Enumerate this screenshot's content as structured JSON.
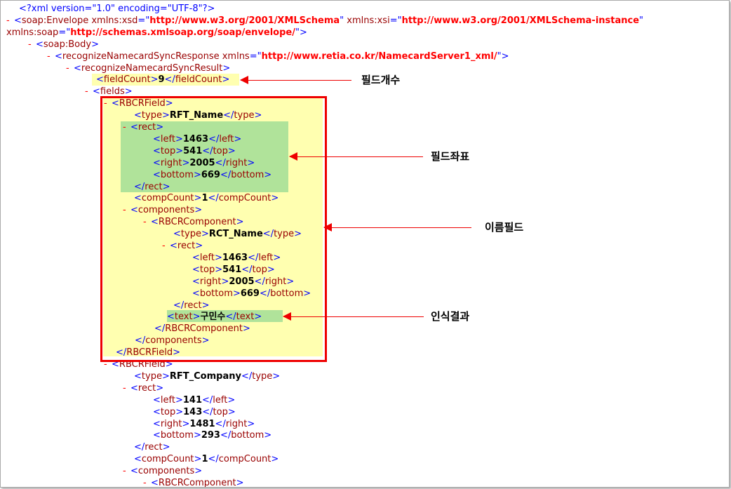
{
  "xml_lines": [
    {
      "parts": [
        {
          "t": "<?xml version=\"1.0\" encoding=\"UTF-8\"?>",
          "c": "p"
        }
      ]
    },
    {
      "parts": [
        {
          "t": "-",
          "c": "m"
        },
        {
          "t": "<",
          "c": "p"
        },
        {
          "t": "soap:Envelope",
          "c": "tn"
        },
        {
          "t": " xmlns:xsd",
          "c": "an"
        },
        {
          "t": "=\"",
          "c": "p"
        },
        {
          "t": "http://www.w3.org/2001/XMLSchema",
          "c": "av"
        },
        {
          "t": "\"",
          "c": "p"
        },
        {
          "t": " xmlns:xsi",
          "c": "an"
        },
        {
          "t": "=\"",
          "c": "p"
        },
        {
          "t": "http://www.w3.org/2001/XMLSchema-instance",
          "c": "av"
        },
        {
          "t": "\"",
          "c": "p"
        }
      ]
    },
    {
      "parts": [
        {
          "t": "xmlns:soap",
          "c": "an"
        },
        {
          "t": "=\"",
          "c": "p"
        },
        {
          "t": "http://schemas.xmlsoap.org/soap/envelope/",
          "c": "av"
        },
        {
          "t": "\">",
          "c": "p"
        }
      ]
    },
    {
      "parts": [
        {
          "t": "-",
          "c": "m"
        },
        {
          "t": "<",
          "c": "p"
        },
        {
          "t": "soap:Body",
          "c": "tn"
        },
        {
          "t": ">",
          "c": "p"
        }
      ]
    },
    {
      "parts": [
        {
          "t": "-",
          "c": "m"
        },
        {
          "t": "<",
          "c": "p"
        },
        {
          "t": "recognizeNamecardSyncResponse",
          "c": "tn"
        },
        {
          "t": " xmlns",
          "c": "an"
        },
        {
          "t": "=\"",
          "c": "p"
        },
        {
          "t": "http://www.retia.co.kr/NamecardServer1_xml/",
          "c": "av"
        },
        {
          "t": "\">",
          "c": "p"
        }
      ]
    },
    {
      "parts": [
        {
          "t": "-",
          "c": "m"
        },
        {
          "t": "<",
          "c": "p"
        },
        {
          "t": "recognizeNamecardSyncResult",
          "c": "tn"
        },
        {
          "t": ">",
          "c": "p"
        }
      ]
    },
    {
      "parts": [
        {
          "t": "<",
          "c": "p"
        },
        {
          "t": "fieldCount",
          "c": "tn"
        },
        {
          "t": ">",
          "c": "p"
        },
        {
          "t": "9",
          "c": "tx"
        },
        {
          "t": "</",
          "c": "p"
        },
        {
          "t": "fieldCount",
          "c": "tn"
        },
        {
          "t": ">",
          "c": "p"
        }
      ]
    },
    {
      "parts": [
        {
          "t": "-",
          "c": "m"
        },
        {
          "t": "<",
          "c": "p"
        },
        {
          "t": "fields",
          "c": "tn"
        },
        {
          "t": ">",
          "c": "p"
        }
      ]
    },
    {
      "parts": [
        {
          "t": "-",
          "c": "m"
        },
        {
          "t": "<",
          "c": "p"
        },
        {
          "t": "RBCRField",
          "c": "tn"
        },
        {
          "t": ">",
          "c": "p"
        }
      ]
    },
    {
      "parts": [
        {
          "t": "<",
          "c": "p"
        },
        {
          "t": "type",
          "c": "tn"
        },
        {
          "t": ">",
          "c": "p"
        },
        {
          "t": "RFT_Name",
          "c": "tx"
        },
        {
          "t": "</",
          "c": "p"
        },
        {
          "t": "type",
          "c": "tn"
        },
        {
          "t": ">",
          "c": "p"
        }
      ]
    },
    {
      "parts": [
        {
          "t": "-",
          "c": "m"
        },
        {
          "t": "<",
          "c": "p"
        },
        {
          "t": "rect",
          "c": "tn"
        },
        {
          "t": ">",
          "c": "p"
        }
      ]
    },
    {
      "parts": [
        {
          "t": "<",
          "c": "p"
        },
        {
          "t": "left",
          "c": "tn"
        },
        {
          "t": ">",
          "c": "p"
        },
        {
          "t": "1463",
          "c": "tx"
        },
        {
          "t": "</",
          "c": "p"
        },
        {
          "t": "left",
          "c": "tn"
        },
        {
          "t": ">",
          "c": "p"
        }
      ]
    },
    {
      "parts": [
        {
          "t": "<",
          "c": "p"
        },
        {
          "t": "top",
          "c": "tn"
        },
        {
          "t": ">",
          "c": "p"
        },
        {
          "t": "541",
          "c": "tx"
        },
        {
          "t": "</",
          "c": "p"
        },
        {
          "t": "top",
          "c": "tn"
        },
        {
          "t": ">",
          "c": "p"
        }
      ]
    },
    {
      "parts": [
        {
          "t": "<",
          "c": "p"
        },
        {
          "t": "right",
          "c": "tn"
        },
        {
          "t": ">",
          "c": "p"
        },
        {
          "t": "2005",
          "c": "tx"
        },
        {
          "t": "</",
          "c": "p"
        },
        {
          "t": "right",
          "c": "tn"
        },
        {
          "t": ">",
          "c": "p"
        }
      ]
    },
    {
      "parts": [
        {
          "t": "<",
          "c": "p"
        },
        {
          "t": "bottom",
          "c": "tn"
        },
        {
          "t": ">",
          "c": "p"
        },
        {
          "t": "669",
          "c": "tx"
        },
        {
          "t": "</",
          "c": "p"
        },
        {
          "t": "bottom",
          "c": "tn"
        },
        {
          "t": ">",
          "c": "p"
        }
      ]
    },
    {
      "parts": [
        {
          "t": "</",
          "c": "p"
        },
        {
          "t": "rect",
          "c": "tn"
        },
        {
          "t": ">",
          "c": "p"
        }
      ]
    },
    {
      "parts": [
        {
          "t": "<",
          "c": "p"
        },
        {
          "t": "compCount",
          "c": "tn"
        },
        {
          "t": ">",
          "c": "p"
        },
        {
          "t": "1",
          "c": "tx"
        },
        {
          "t": "</",
          "c": "p"
        },
        {
          "t": "compCount",
          "c": "tn"
        },
        {
          "t": ">",
          "c": "p"
        }
      ]
    },
    {
      "parts": [
        {
          "t": "-",
          "c": "m"
        },
        {
          "t": "<",
          "c": "p"
        },
        {
          "t": "components",
          "c": "tn"
        },
        {
          "t": ">",
          "c": "p"
        }
      ]
    },
    {
      "parts": [
        {
          "t": "-",
          "c": "m"
        },
        {
          "t": "<",
          "c": "p"
        },
        {
          "t": "RBCRComponent",
          "c": "tn"
        },
        {
          "t": ">",
          "c": "p"
        }
      ]
    },
    {
      "parts": [
        {
          "t": "<",
          "c": "p"
        },
        {
          "t": "type",
          "c": "tn"
        },
        {
          "t": ">",
          "c": "p"
        },
        {
          "t": "RCT_Name",
          "c": "tx"
        },
        {
          "t": "</",
          "c": "p"
        },
        {
          "t": "type",
          "c": "tn"
        },
        {
          "t": ">",
          "c": "p"
        }
      ]
    },
    {
      "parts": [
        {
          "t": "-",
          "c": "m"
        },
        {
          "t": "<",
          "c": "p"
        },
        {
          "t": "rect",
          "c": "tn"
        },
        {
          "t": ">",
          "c": "p"
        }
      ]
    },
    {
      "parts": [
        {
          "t": "<",
          "c": "p"
        },
        {
          "t": "left",
          "c": "tn"
        },
        {
          "t": ">",
          "c": "p"
        },
        {
          "t": "1463",
          "c": "tx"
        },
        {
          "t": "</",
          "c": "p"
        },
        {
          "t": "left",
          "c": "tn"
        },
        {
          "t": ">",
          "c": "p"
        }
      ]
    },
    {
      "parts": [
        {
          "t": "<",
          "c": "p"
        },
        {
          "t": "top",
          "c": "tn"
        },
        {
          "t": ">",
          "c": "p"
        },
        {
          "t": "541",
          "c": "tx"
        },
        {
          "t": "</",
          "c": "p"
        },
        {
          "t": "top",
          "c": "tn"
        },
        {
          "t": ">",
          "c": "p"
        }
      ]
    },
    {
      "parts": [
        {
          "t": "<",
          "c": "p"
        },
        {
          "t": "right",
          "c": "tn"
        },
        {
          "t": ">",
          "c": "p"
        },
        {
          "t": "2005",
          "c": "tx"
        },
        {
          "t": "</",
          "c": "p"
        },
        {
          "t": "right",
          "c": "tn"
        },
        {
          "t": ">",
          "c": "p"
        }
      ]
    },
    {
      "parts": [
        {
          "t": "<",
          "c": "p"
        },
        {
          "t": "bottom",
          "c": "tn"
        },
        {
          "t": ">",
          "c": "p"
        },
        {
          "t": "669",
          "c": "tx"
        },
        {
          "t": "</",
          "c": "p"
        },
        {
          "t": "bottom",
          "c": "tn"
        },
        {
          "t": ">",
          "c": "p"
        }
      ]
    },
    {
      "parts": [
        {
          "t": "</",
          "c": "p"
        },
        {
          "t": "rect",
          "c": "tn"
        },
        {
          "t": ">",
          "c": "p"
        }
      ]
    },
    {
      "parts": [
        {
          "t": "<",
          "c": "p"
        },
        {
          "t": "text",
          "c": "tn"
        },
        {
          "t": ">",
          "c": "p"
        },
        {
          "t": "구민수",
          "c": "tx"
        },
        {
          "t": "</",
          "c": "p"
        },
        {
          "t": "text",
          "c": "tn"
        },
        {
          "t": ">",
          "c": "p"
        }
      ]
    },
    {
      "parts": [
        {
          "t": "</",
          "c": "p"
        },
        {
          "t": "RBCRComponent",
          "c": "tn"
        },
        {
          "t": ">",
          "c": "p"
        }
      ]
    },
    {
      "parts": [
        {
          "t": "</",
          "c": "p"
        },
        {
          "t": "components",
          "c": "tn"
        },
        {
          "t": ">",
          "c": "p"
        }
      ]
    },
    {
      "parts": [
        {
          "t": "</",
          "c": "p"
        },
        {
          "t": "RBCRField",
          "c": "tn"
        },
        {
          "t": ">",
          "c": "p"
        }
      ]
    },
    {
      "parts": [
        {
          "t": "-",
          "c": "m"
        },
        {
          "t": "<",
          "c": "p"
        },
        {
          "t": "RBCRField",
          "c": "tn"
        },
        {
          "t": ">",
          "c": "p"
        }
      ]
    },
    {
      "parts": [
        {
          "t": "<",
          "c": "p"
        },
        {
          "t": "type",
          "c": "tn"
        },
        {
          "t": ">",
          "c": "p"
        },
        {
          "t": "RFT_Company",
          "c": "tx"
        },
        {
          "t": "</",
          "c": "p"
        },
        {
          "t": "type",
          "c": "tn"
        },
        {
          "t": ">",
          "c": "p"
        }
      ]
    },
    {
      "parts": [
        {
          "t": "-",
          "c": "m"
        },
        {
          "t": "<",
          "c": "p"
        },
        {
          "t": "rect",
          "c": "tn"
        },
        {
          "t": ">",
          "c": "p"
        }
      ]
    },
    {
      "parts": [
        {
          "t": "<",
          "c": "p"
        },
        {
          "t": "left",
          "c": "tn"
        },
        {
          "t": ">",
          "c": "p"
        },
        {
          "t": "141",
          "c": "tx"
        },
        {
          "t": "</",
          "c": "p"
        },
        {
          "t": "left",
          "c": "tn"
        },
        {
          "t": ">",
          "c": "p"
        }
      ]
    },
    {
      "parts": [
        {
          "t": "<",
          "c": "p"
        },
        {
          "t": "top",
          "c": "tn"
        },
        {
          "t": ">",
          "c": "p"
        },
        {
          "t": "143",
          "c": "tx"
        },
        {
          "t": "</",
          "c": "p"
        },
        {
          "t": "top",
          "c": "tn"
        },
        {
          "t": ">",
          "c": "p"
        }
      ]
    },
    {
      "parts": [
        {
          "t": "<",
          "c": "p"
        },
        {
          "t": "right",
          "c": "tn"
        },
        {
          "t": ">",
          "c": "p"
        },
        {
          "t": "1481",
          "c": "tx"
        },
        {
          "t": "</",
          "c": "p"
        },
        {
          "t": "right",
          "c": "tn"
        },
        {
          "t": ">",
          "c": "p"
        }
      ]
    },
    {
      "parts": [
        {
          "t": "<",
          "c": "p"
        },
        {
          "t": "bottom",
          "c": "tn"
        },
        {
          "t": ">",
          "c": "p"
        },
        {
          "t": "293",
          "c": "tx"
        },
        {
          "t": "</",
          "c": "p"
        },
        {
          "t": "bottom",
          "c": "tn"
        },
        {
          "t": ">",
          "c": "p"
        }
      ]
    },
    {
      "parts": [
        {
          "t": "</",
          "c": "p"
        },
        {
          "t": "rect",
          "c": "tn"
        },
        {
          "t": ">",
          "c": "p"
        }
      ]
    },
    {
      "parts": [
        {
          "t": "<",
          "c": "p"
        },
        {
          "t": "compCount",
          "c": "tn"
        },
        {
          "t": ">",
          "c": "p"
        },
        {
          "t": "1",
          "c": "tx"
        },
        {
          "t": "</",
          "c": "p"
        },
        {
          "t": "compCount",
          "c": "tn"
        },
        {
          "t": ">",
          "c": "p"
        }
      ]
    },
    {
      "parts": [
        {
          "t": "-",
          "c": "m"
        },
        {
          "t": "<",
          "c": "p"
        },
        {
          "t": "components",
          "c": "tn"
        },
        {
          "t": ">",
          "c": "p"
        }
      ]
    },
    {
      "parts": [
        {
          "t": "-",
          "c": "m"
        },
        {
          "t": "<",
          "c": "p"
        },
        {
          "t": "RBCRComponent",
          "c": "tn"
        },
        {
          "t": ">",
          "c": "p"
        }
      ]
    }
  ],
  "callouts": {
    "field_count": "필드개수",
    "field_coords": "필드좌표",
    "name_field": "이름필드",
    "recognition_result": "인식결과"
  },
  "colors": {
    "markup": "#0000ff",
    "tag_name": "#990000",
    "attr_value": "#ff0000",
    "text_value": "#000000",
    "annotation_red": "#ee0000",
    "highlight_yellow": "#ffffb0",
    "highlight_green": "#b0e39a"
  }
}
